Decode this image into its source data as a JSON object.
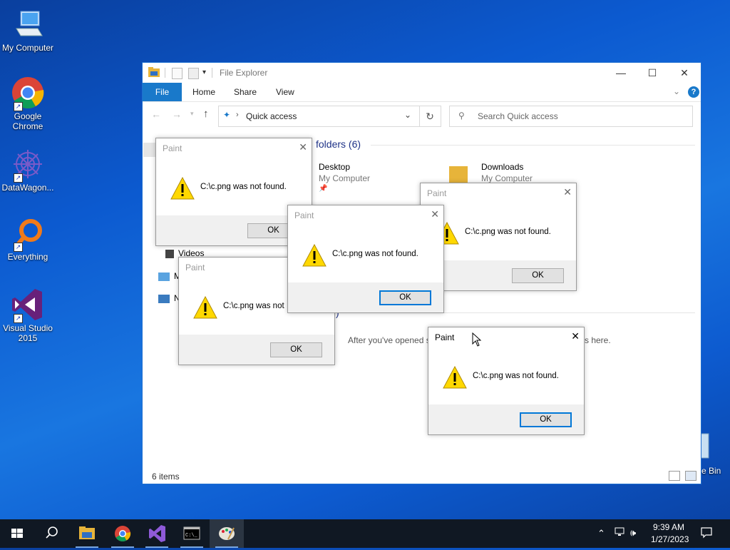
{
  "desktop": {
    "icons": [
      {
        "label": "My Computer",
        "icon": "computer-icon"
      },
      {
        "label": "Google Chrome",
        "icon": "chrome-icon"
      },
      {
        "label": "DataWagon...",
        "icon": "datawagon-icon"
      },
      {
        "label": "Everything",
        "icon": "everything-icon"
      },
      {
        "label": "Visual Studio 2015",
        "icon": "visual-studio-icon"
      },
      {
        "label": "e Bin",
        "icon": "recycle-bin-icon"
      }
    ]
  },
  "explorer": {
    "title": "File Explorer",
    "ribbon_tabs": [
      "File",
      "Home",
      "Share",
      "View"
    ],
    "address": "Quick access",
    "search_placeholder": "Search Quick access",
    "section_frequent": "folders (6)",
    "folders": [
      {
        "name": "Desktop",
        "location": "My Computer"
      },
      {
        "name": "Downloads",
        "location": "My Computer"
      }
    ],
    "nav_items": [
      "Videos",
      "M",
      "N"
    ],
    "section_recent_fragment": ")",
    "empty_text_left": "After you've opened s",
    "empty_text_right": "s here.",
    "status": "6 items",
    "colors": {
      "accent": "#1979ca"
    }
  },
  "dialogs": [
    {
      "title": "Paint",
      "message": "C:\\c.png was not found.",
      "ok": "OK"
    },
    {
      "title": "Paint",
      "message": "C:\\c.png was not found.",
      "ok": "OK"
    },
    {
      "title": "Paint",
      "message": "C:\\c.png was not",
      "ok": "OK"
    },
    {
      "title": "Paint",
      "message": "C:\\c.png was not found.",
      "ok": "OK"
    },
    {
      "title": "Paint",
      "message": "C:\\c.png was not found.",
      "ok": "OK"
    }
  ],
  "taskbar": {
    "time": "9:39 AM",
    "date": "1/27/2023",
    "apps": [
      "start-icon",
      "search-icon",
      "file-explorer-icon",
      "chrome-icon",
      "visual-studio-icon",
      "terminal-icon",
      "paint-icon"
    ]
  }
}
